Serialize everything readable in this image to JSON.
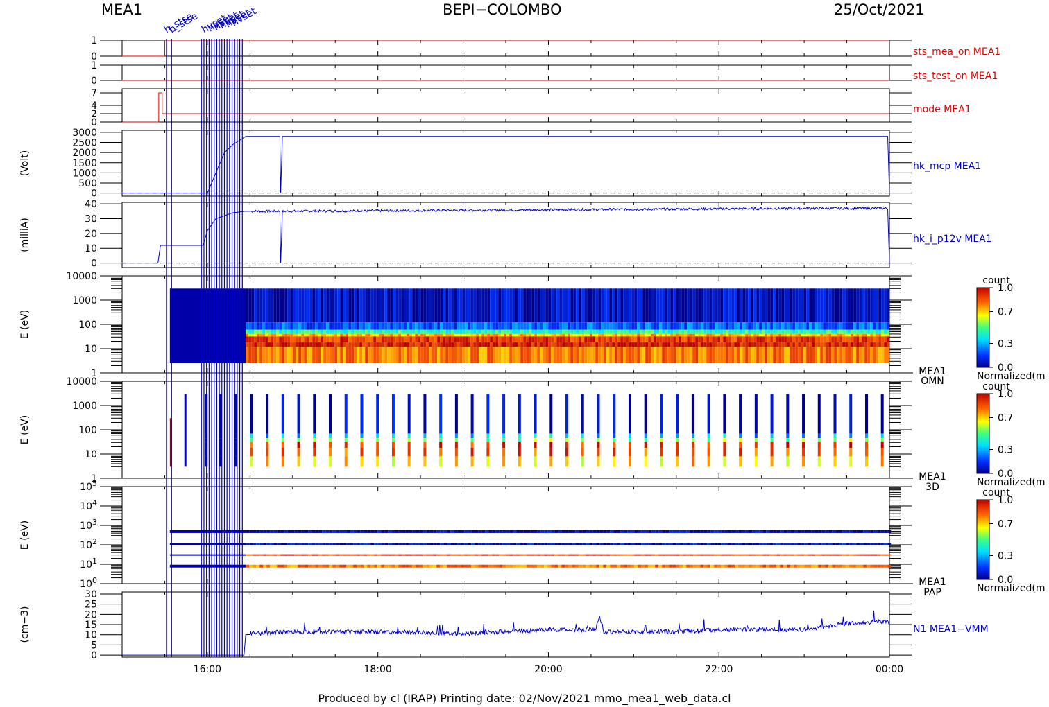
{
  "header": {
    "left": "MEA1",
    "center": "BEPI−COLOMBO",
    "right": "25/Oct/2021"
  },
  "footer": {
    "text": "Produced by cl (IRAP)    Printing date: 02/Nov/2021    mmo_mea1_web_data.cl"
  },
  "colors": {
    "red": "#e00000",
    "blue": "#0000c8",
    "frame": "#000000"
  },
  "chart_data": {
    "type": "multi-panel time series",
    "x": {
      "unit": "hours UT",
      "range": [
        15.0,
        24.0
      ],
      "ticks": [
        16,
        18,
        20,
        22,
        24
      ],
      "tick_labels": [
        "16:00",
        "18:00",
        "20:00",
        "22:00",
        "00:00"
      ]
    },
    "event_markers": {
      "times": [
        15.52,
        15.58,
        15.93,
        15.96,
        15.99,
        16.02,
        16.05,
        16.08,
        16.11,
        16.14,
        16.17,
        16.2,
        16.23,
        16.26,
        16.29,
        16.32,
        16.35,
        16.38,
        16.41
      ],
      "top_labels": [
        "h_stse",
        "hvset"
      ]
    },
    "panels": [
      {
        "name": "sts_mea_on",
        "label": "sts_mea_on  MEA1",
        "color": "#e00000",
        "ylabel": "",
        "ylim": [
          0,
          1
        ],
        "ytick_labels": [
          "0",
          "1"
        ],
        "series": [
          [
            15.0,
            0
          ],
          [
            15.5,
            0
          ],
          [
            15.5,
            1
          ],
          [
            24.0,
            1
          ]
        ]
      },
      {
        "name": "sts_test_on",
        "label": "sts_test_on  MEA1",
        "color": "#e00000",
        "ylabel": "",
        "ylim": [
          0,
          1
        ],
        "ytick_labels": [
          "0",
          "1"
        ],
        "series": [
          [
            15.0,
            0
          ],
          [
            24.0,
            0
          ]
        ]
      },
      {
        "name": "mode",
        "label": "mode  MEA1",
        "color": "#e00000",
        "ylabel": "",
        "ylim": [
          0,
          8
        ],
        "ytick_labels": [
          "0",
          "2",
          "4",
          "7"
        ],
        "series": [
          [
            15.0,
            0
          ],
          [
            15.43,
            0
          ],
          [
            15.43,
            7
          ],
          [
            15.47,
            7
          ],
          [
            15.47,
            2
          ],
          [
            24.0,
            2
          ]
        ]
      },
      {
        "name": "hk_mcp",
        "label": "hk_mcp  MEA1",
        "color": "#0000c8",
        "ylabel": "(Volt)",
        "ylim": [
          -150,
          3100
        ],
        "ytick_labels": [
          "0",
          "500",
          "1000",
          "1500",
          "2000",
          "2500",
          "3000"
        ],
        "series": [
          [
            15.0,
            0
          ],
          [
            16.0,
            0
          ],
          [
            16.05,
            500
          ],
          [
            16.2,
            2000
          ],
          [
            16.3,
            2400
          ],
          [
            16.45,
            2800
          ],
          [
            16.85,
            2800
          ],
          [
            16.86,
            0
          ],
          [
            16.88,
            2800
          ],
          [
            23.98,
            2800
          ],
          [
            24.0,
            0
          ]
        ],
        "dashed_zero": true
      },
      {
        "name": "hk_i_p12v",
        "label": "hk_i_p12v  MEA1",
        "color": "#0000c8",
        "ylabel": "(milliA)",
        "ylim": [
          -3,
          41
        ],
        "ytick_labels": [
          "0",
          "10",
          "20",
          "30",
          "40"
        ],
        "series": [
          [
            15.0,
            0
          ],
          [
            15.42,
            0
          ],
          [
            15.45,
            12
          ],
          [
            15.95,
            12
          ],
          [
            16.0,
            22
          ],
          [
            16.1,
            30
          ],
          [
            16.3,
            34
          ],
          [
            16.45,
            35
          ],
          [
            16.85,
            35
          ],
          [
            16.86,
            0
          ],
          [
            16.88,
            35
          ],
          [
            20.0,
            36
          ],
          [
            23.0,
            37
          ],
          [
            23.98,
            37
          ],
          [
            24.0,
            0
          ]
        ],
        "dashed_zero": true
      },
      {
        "name": "omn",
        "label": "MEA1 OMN",
        "type": "spectrogram",
        "ylabel": "E (eV)",
        "yscale": "log",
        "ylim": [
          1,
          10000
        ],
        "ytick_labels": [
          "1",
          "10",
          "100",
          "1000",
          "10000"
        ],
        "colorbar": {
          "title": "count",
          "label": "Normalized(m",
          "ticks": [
            "0.0",
            "0.3",
            "0.7",
            "1.0"
          ]
        }
      },
      {
        "name": "3d",
        "label": "MEA1 3D",
        "type": "spectrogram",
        "ylabel": "E (eV)",
        "yscale": "log",
        "ylim": [
          1,
          10000
        ],
        "ytick_labels": [
          "1",
          "10",
          "100",
          "1000",
          "10000"
        ],
        "colorbar": {
          "title": "count",
          "label": "Normalized(m",
          "ticks": [
            "0.0",
            "0.3",
            "0.7",
            "1.0"
          ]
        }
      },
      {
        "name": "pap",
        "label": "MEA1 PAP",
        "type": "spectrogram",
        "ylabel": "E (eV)",
        "yscale": "log",
        "ylim": [
          1,
          100000
        ],
        "ytick_labels": [
          "10^0",
          "10^1",
          "10^2",
          "10^3",
          "10^4",
          "10^5"
        ],
        "colorbar": {
          "title": "count",
          "label": "Normalized(m",
          "ticks": [
            "0.0",
            "0.3",
            "0.7",
            "1.0"
          ]
        }
      },
      {
        "name": "n1",
        "label": "N1  MEA1−VMM",
        "color": "#0000c8",
        "ylabel": "(cm−3)",
        "ylim": [
          -1,
          31
        ],
        "ytick_labels": [
          "0",
          "5",
          "10",
          "15",
          "20",
          "25",
          "30"
        ],
        "series": [
          [
            15.0,
            0
          ],
          [
            16.43,
            0
          ],
          [
            16.45,
            10
          ],
          [
            17.0,
            11
          ],
          [
            18.0,
            11
          ],
          [
            19.0,
            10
          ],
          [
            20.0,
            12
          ],
          [
            20.55,
            12
          ],
          [
            20.6,
            19
          ],
          [
            20.65,
            11
          ],
          [
            21.5,
            11
          ],
          [
            22.0,
            12
          ],
          [
            23.0,
            12
          ],
          [
            23.5,
            15
          ],
          [
            24.0,
            16
          ]
        ]
      }
    ]
  }
}
